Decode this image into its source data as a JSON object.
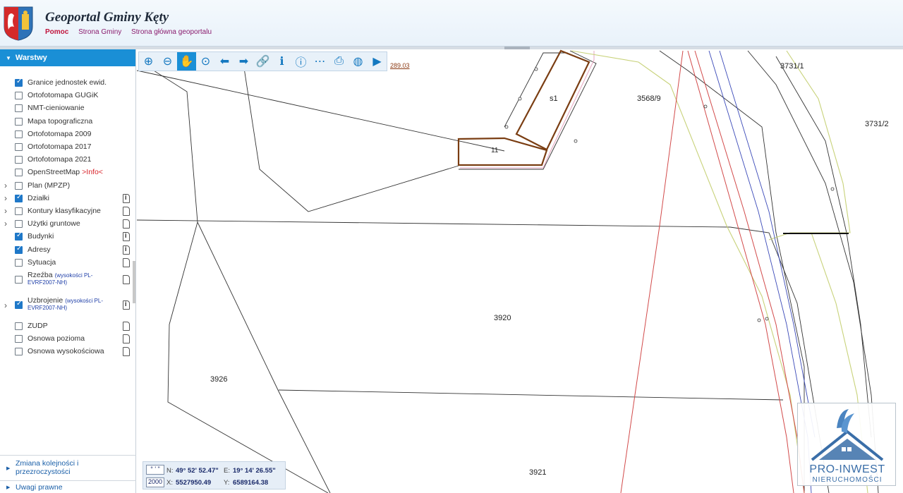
{
  "header": {
    "title": "Geoportal Gminy Kęty",
    "links": [
      {
        "label": "Pomoc",
        "active": true
      },
      {
        "label": "Strona Gminy",
        "active": false
      },
      {
        "label": "Strona główna geoportalu",
        "active": false
      }
    ]
  },
  "sidebar": {
    "panel_title": "Warstwy",
    "layers": [
      {
        "label": "Granice jednostek ewid.",
        "checked": true,
        "expandable": false,
        "icon": ""
      },
      {
        "label": "Ortofotomapa GUGiK",
        "checked": false,
        "expandable": false,
        "icon": ""
      },
      {
        "label": "NMT-cieniowanie",
        "checked": false,
        "expandable": false,
        "icon": ""
      },
      {
        "label": "Mapa topograficzna",
        "checked": false,
        "expandable": false,
        "icon": ""
      },
      {
        "label": "Ortofotomapa 2009",
        "checked": false,
        "expandable": false,
        "icon": ""
      },
      {
        "label": "Ortofotomapa 2017",
        "checked": false,
        "expandable": false,
        "icon": ""
      },
      {
        "label": "Ortofotomapa 2021",
        "checked": false,
        "expandable": false,
        "icon": ""
      },
      {
        "label": "OpenStreetMap",
        "link": ">Info<",
        "checked": false,
        "expandable": false,
        "icon": ""
      },
      {
        "label": "Plan (MPZP)",
        "checked": false,
        "expandable": true,
        "icon": ""
      },
      {
        "label": "Działki",
        "checked": true,
        "expandable": true,
        "icon": "info-doc-icon"
      },
      {
        "label": "Kontury klasyfikacyjne",
        "checked": false,
        "expandable": true,
        "icon": "doc-icon"
      },
      {
        "label": "Użytki gruntowe",
        "checked": false,
        "expandable": true,
        "icon": "doc-icon"
      },
      {
        "label": "Budynki",
        "checked": true,
        "expandable": false,
        "icon": "info-doc-icon"
      },
      {
        "label": "Adresy",
        "checked": true,
        "expandable": false,
        "icon": "info-doc-icon"
      },
      {
        "label": "Sytuacja",
        "checked": false,
        "expandable": false,
        "icon": "doc-icon"
      },
      {
        "label": "Rzeźba",
        "sub": "(wysokości PL-",
        "sub2": "EVRF2007-NH)",
        "checked": false,
        "expandable": false,
        "icon": "doc-icon"
      },
      {
        "label": "Uzbrojenie",
        "sub": "(wysokości PL-",
        "sub2": "EVRF2007-NH)",
        "checked": true,
        "expandable": true,
        "icon": "info-doc-icon"
      },
      {
        "label": "ZUDP",
        "checked": false,
        "expandable": false,
        "icon": "doc-icon"
      },
      {
        "label": "Osnowa pozioma",
        "checked": false,
        "expandable": false,
        "icon": "doc-icon"
      },
      {
        "label": "Osnowa wysokościowa",
        "checked": false,
        "expandable": false,
        "icon": "doc-icon"
      }
    ],
    "footer": [
      {
        "line1": "Zmiana kolejności i",
        "line2": "przezroczystości"
      },
      {
        "line1": "Uwagi prawne",
        "line2": ""
      }
    ]
  },
  "toolbar": {
    "tools": [
      {
        "name": "zoom-in-icon",
        "glyph": "⊕"
      },
      {
        "name": "zoom-out-icon",
        "glyph": "⊖"
      },
      {
        "name": "pan-hand-icon",
        "glyph": "✋",
        "active": true
      },
      {
        "name": "zoom-box-icon",
        "glyph": "⊙"
      },
      {
        "name": "arrow-back-icon",
        "glyph": "⬅"
      },
      {
        "name": "arrow-forward-icon",
        "glyph": "➡"
      },
      {
        "name": "link-icon",
        "glyph": "🔗"
      },
      {
        "name": "info-icon",
        "glyph": "ℹ"
      },
      {
        "name": "info-query-icon",
        "glyph": "ⓘ"
      },
      {
        "name": "measure-icon",
        "glyph": "⋯"
      },
      {
        "name": "print-icon",
        "glyph": "⎙"
      },
      {
        "name": "globe-icon",
        "glyph": "◍"
      },
      {
        "name": "camera-icon",
        "glyph": "▶"
      }
    ]
  },
  "map": {
    "scale_label": "289.03",
    "parcels": [
      "s1",
      "3568/9",
      "3731/1",
      "3731/2",
      "11",
      "3920",
      "3926",
      "3921"
    ]
  },
  "coords": {
    "dms_box": "° ' \"",
    "epsg_box": "2000",
    "n_label": "N:",
    "n_value": "49° 52' 52.47\"",
    "e_label": "E:",
    "e_value": "19° 14' 26.55\"",
    "x_label": "X:",
    "x_value": "5527950.49",
    "y_label": "Y:",
    "y_value": "6589164.38"
  },
  "watermark": {
    "name": "PRO-INWEST",
    "sub": "NIERUCHOMOŚCI"
  }
}
